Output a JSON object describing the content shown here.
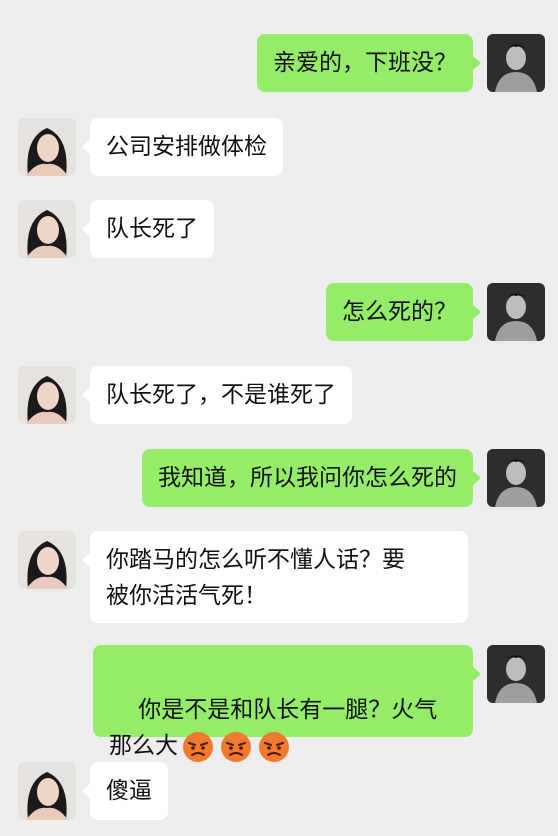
{
  "messages": [
    {
      "sender": "me",
      "text": "亲爱的，下班没？"
    },
    {
      "sender": "them",
      "text": "公司安排做体检"
    },
    {
      "sender": "them",
      "text": "队长死了"
    },
    {
      "sender": "me",
      "text": "怎么死的？"
    },
    {
      "sender": "them",
      "text": "队长死了，不是谁死了"
    },
    {
      "sender": "me",
      "text": "我知道，所以我问你怎么死的"
    },
    {
      "sender": "them",
      "text": "你踏马的怎么听不懂人话？要\n被你活活气死！"
    },
    {
      "sender": "me",
      "text": "你是不是和队长有一腿？火气\n那么大",
      "emoji": [
        "angry-face",
        "angry-face",
        "angry-face"
      ]
    },
    {
      "sender": "them",
      "text": "傻逼"
    }
  ],
  "colors": {
    "background": "#ededed",
    "me_bubble": "#95ec69",
    "them_bubble": "#ffffff"
  }
}
